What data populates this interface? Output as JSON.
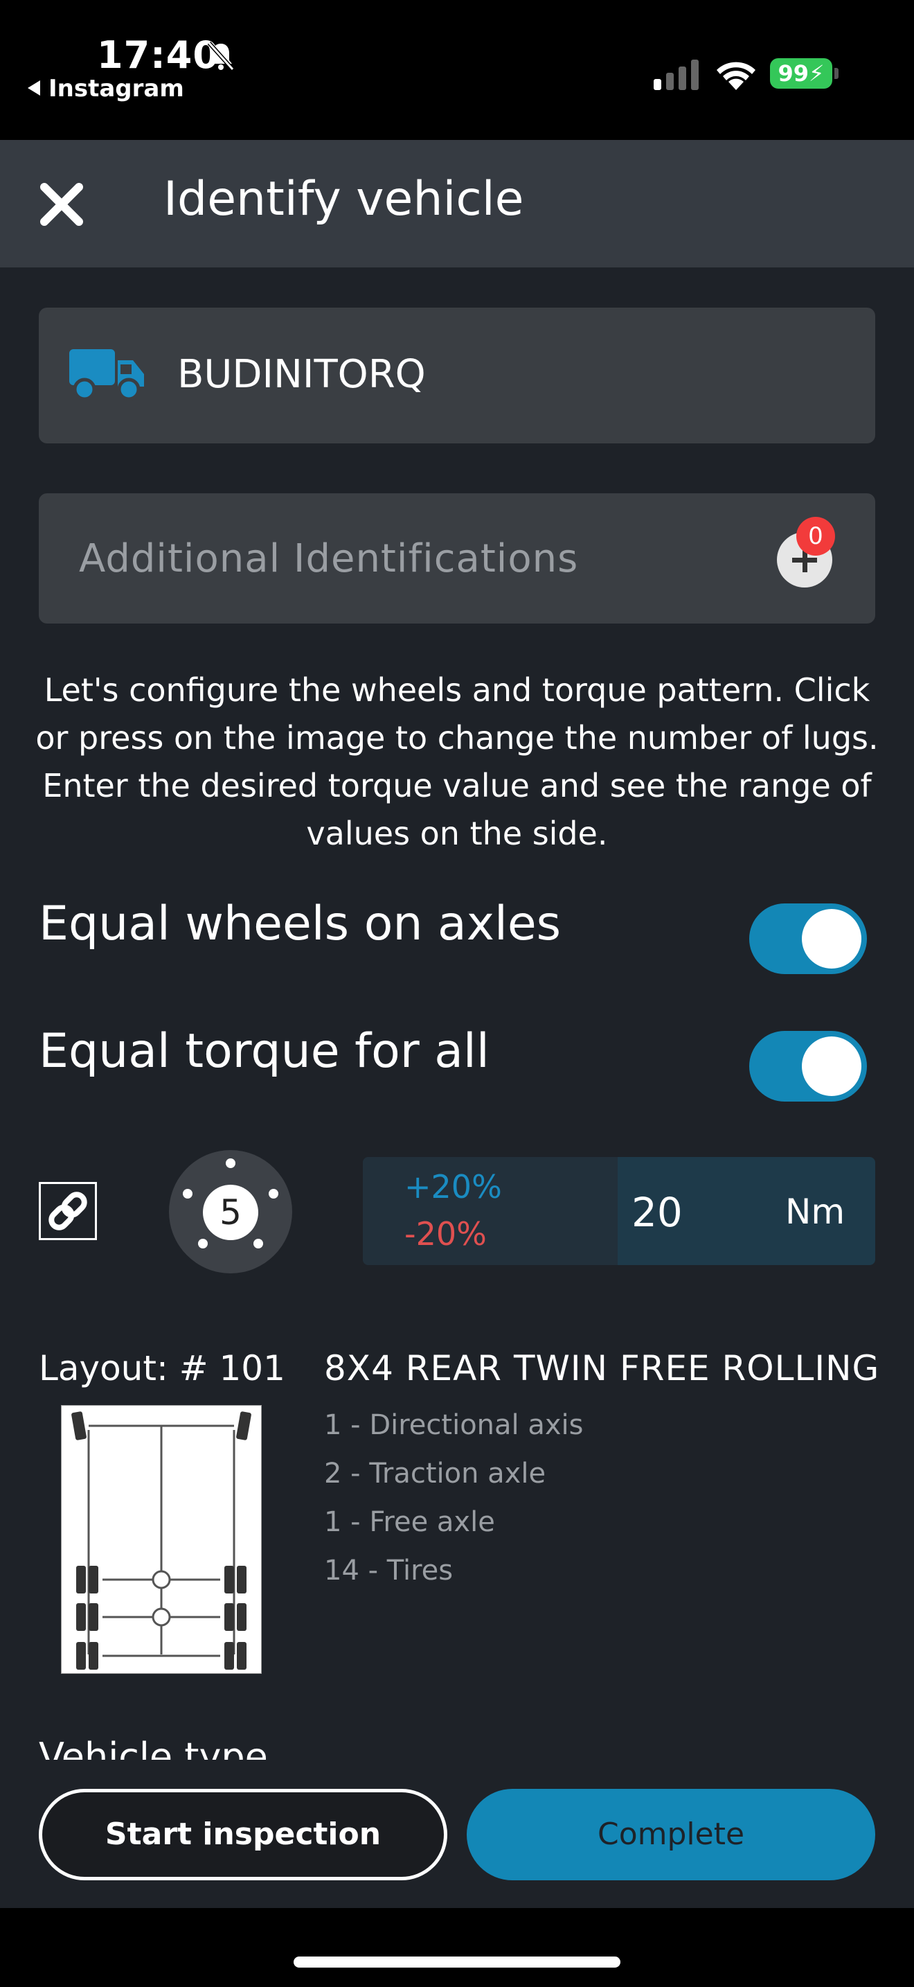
{
  "status_bar": {
    "time": "17:40",
    "back_app": "Instagram",
    "battery": "99"
  },
  "header": {
    "title": "Identify vehicle",
    "close_icon": "close-icon"
  },
  "vehicle": {
    "id": "BUDINITORQ",
    "icon": "truck-icon"
  },
  "additional": {
    "label": "Additional Identifications",
    "count": "0"
  },
  "instructions": "Let's configure the wheels and torque pattern. Click or press on the image to change the number of lugs. Enter the desired torque value and see the range of values on the side.",
  "toggles": {
    "equal_wheels": {
      "label": "Equal wheels on axles",
      "on": true
    },
    "equal_torque": {
      "label": "Equal torque for all",
      "on": true
    }
  },
  "torque": {
    "lugs": "5",
    "plus": "+20%",
    "minus": "-20%",
    "value": "20",
    "unit": "Nm"
  },
  "layout": {
    "label": "Layout: # 101",
    "name": "8X4 REAR TWIN FREE ROLLING",
    "specs": [
      "1 - Directional axis",
      "2 - Traction axle",
      "1 - Free axle",
      "14 - Tires"
    ]
  },
  "vehicle_type_label": "Vehicle type",
  "footer": {
    "start": "Start inspection",
    "complete": "Complete"
  },
  "colors": {
    "accent": "#1387b6",
    "background": "#1e2228",
    "card": "#3a3e43",
    "badge": "#f23b3b",
    "positive": "#1a8cc2",
    "negative": "#e05050"
  }
}
